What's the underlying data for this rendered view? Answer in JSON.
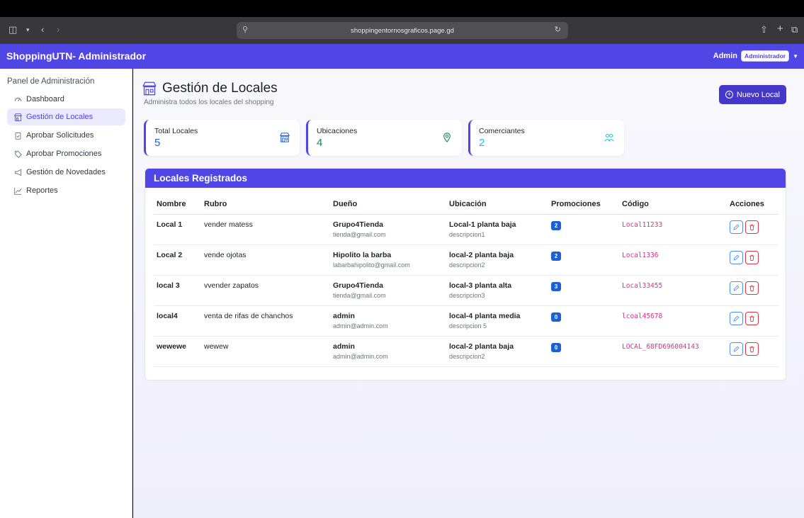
{
  "browser": {
    "url": "shoppingentornosgraficos.page.gd"
  },
  "navbar": {
    "brand": "ShoppingUTN- Administrador",
    "user_name": "Admin",
    "role_badge": "Administrador"
  },
  "sidebar": {
    "title": "Panel de Administración",
    "items": [
      {
        "label": "Dashboard",
        "icon": "gauge-icon",
        "active": false
      },
      {
        "label": "Gestión de Locales",
        "icon": "shop-icon",
        "active": true
      },
      {
        "label": "Aprobar Solicitudes",
        "icon": "clipboard-check-icon",
        "active": false
      },
      {
        "label": "Aprobar Promociones",
        "icon": "tag-icon",
        "active": false
      },
      {
        "label": "Gestión de Novedades",
        "icon": "megaphone-icon",
        "active": false
      },
      {
        "label": "Reportes",
        "icon": "graph-icon",
        "active": false
      }
    ]
  },
  "page": {
    "title": "Gestión de Locales",
    "subtitle": "Administra todos los locales del shopping",
    "new_button": "Nuevo Local"
  },
  "stats": [
    {
      "label": "Total Locales",
      "value": "5",
      "icon": "shop-icon",
      "color": "#1d5fd6"
    },
    {
      "label": "Ubicaciones",
      "value": "4",
      "icon": "map-pin-icon",
      "color": "#198754"
    },
    {
      "label": "Comerciantes",
      "value": "2",
      "icon": "people-icon",
      "color": "#0dcaf0"
    }
  ],
  "table": {
    "title": "Locales Registrados",
    "headers": [
      "Nombre",
      "Rubro",
      "Dueño",
      "Ubicación",
      "Promociones",
      "Código",
      "Acciones"
    ],
    "rows": [
      {
        "nombre": "Local 1",
        "rubro": "vender matess",
        "dueno": "Grupo4Tienda",
        "email": "tienda@gmail.com",
        "ubicacion": "Local-1 planta baja",
        "descripcion": "descripcion1",
        "promociones": "2",
        "codigo": "Local11233"
      },
      {
        "nombre": "Local 2",
        "rubro": "vende ojotas",
        "dueno": "Hipolito la barba",
        "email": "labarbahipolito@gmail.com",
        "ubicacion": "local-2 planta baja",
        "descripcion": "descripcion2",
        "promociones": "2",
        "codigo": "Local1336"
      },
      {
        "nombre": "local 3",
        "rubro": "vvender zapatos",
        "dueno": "Grupo4Tienda",
        "email": "tienda@gmail.com",
        "ubicacion": "local-3 planta alta",
        "descripcion": "descripcion3",
        "promociones": "3",
        "codigo": "Local33455"
      },
      {
        "nombre": "local4",
        "rubro": "venta de rifas de chanchos",
        "dueno": "admin",
        "email": "admin@admin.com",
        "ubicacion": "local-4 planta media",
        "descripcion": "descripcion 5",
        "promociones": "0",
        "codigo": "lcoal45678"
      },
      {
        "nombre": "wewewe",
        "rubro": "wewew",
        "dueno": "admin",
        "email": "admin@admin.com",
        "ubicacion": "local-2 planta baja",
        "descripcion": "descripcion2",
        "promociones": "0",
        "codigo": "LOCAL_68FD696004143"
      }
    ]
  },
  "colors": {
    "primary": "#4f46e5",
    "badge": "#1d5fd6",
    "code": "#d63384",
    "edit": "#4f8df5",
    "delete": "#dc3545"
  }
}
